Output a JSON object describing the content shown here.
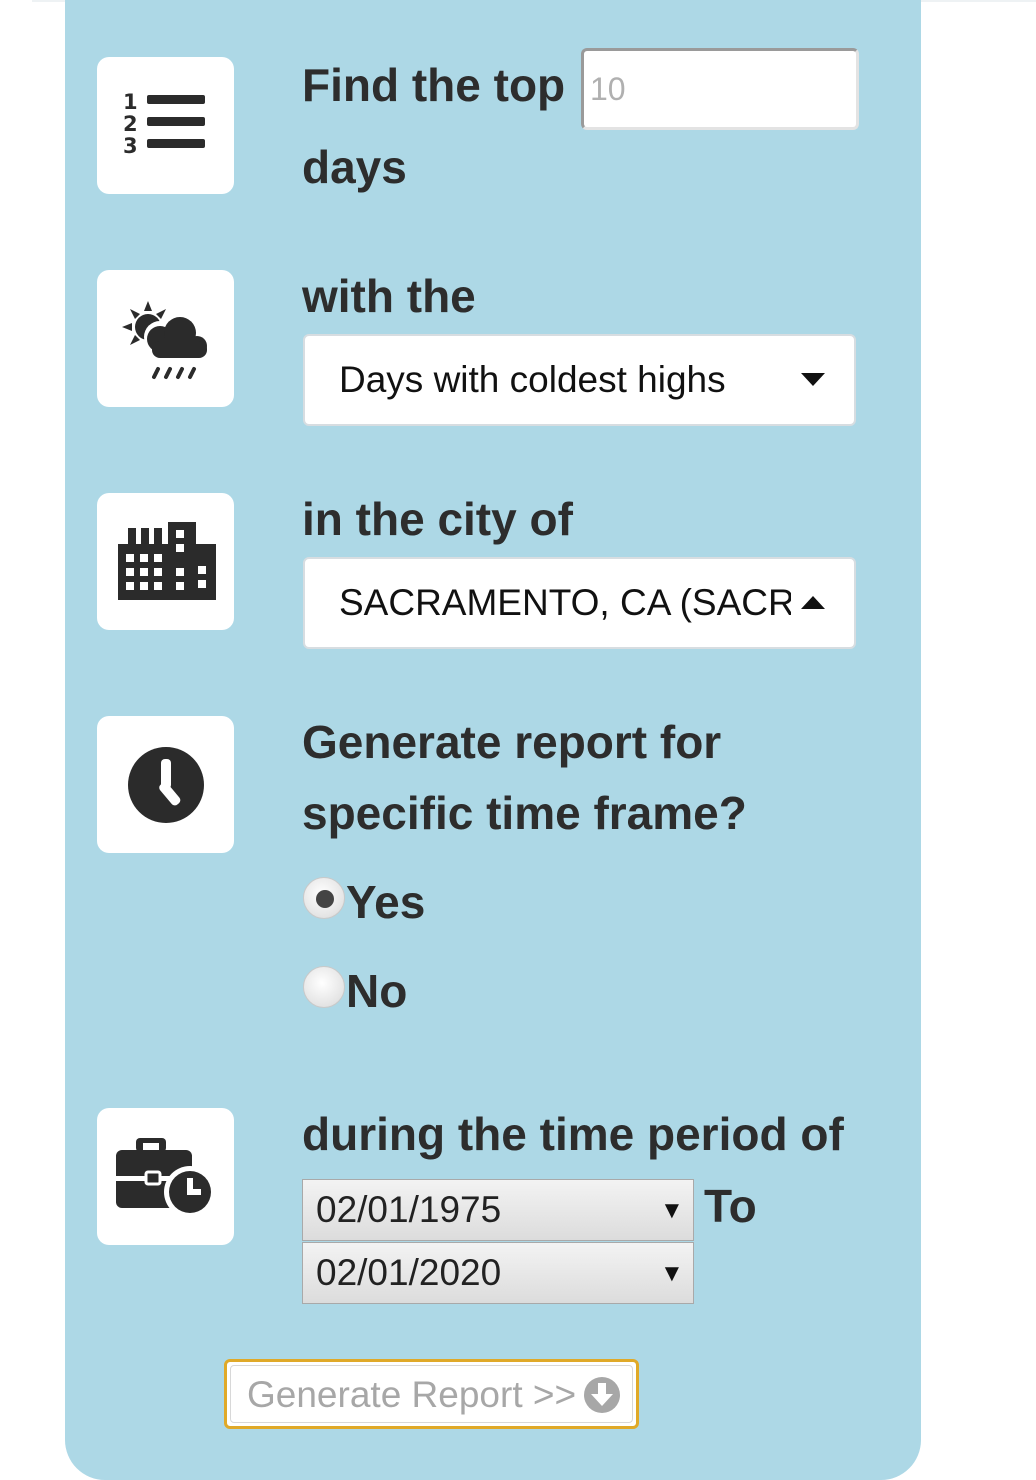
{
  "form": {
    "top_label_1": "Find the top",
    "top_label_2": "days",
    "top_input_placeholder": "10",
    "with_label": "with the",
    "metric_selected": "Days with coldest highs",
    "city_label": "in the city of",
    "city_selected": "SACRAMENTO, CA (SACRAMENTO)",
    "timeframe_question_1": "Generate report for",
    "timeframe_question_2": "specific time frame?",
    "radio_yes": "Yes",
    "radio_no": "No",
    "radio_selected": "Yes",
    "period_label": "during the time period of",
    "start_date": "02/01/1975",
    "to_label": "To",
    "end_date": "02/01/2020",
    "generate_button": "Generate Report >>"
  },
  "icons": {
    "ranking": "numbered-list-icon",
    "weather": "sun-cloud-rain-icon",
    "city": "city-buildings-icon",
    "time": "clock-icon",
    "period": "briefcase-clock-icon",
    "download": "download-circle-icon"
  },
  "colors": {
    "panel": "#add8e6",
    "button_border": "#e0a928"
  }
}
